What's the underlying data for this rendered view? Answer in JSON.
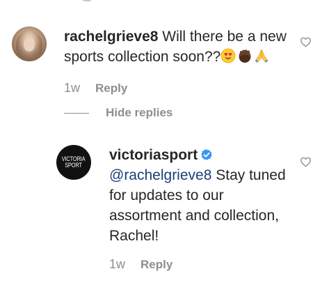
{
  "comments": [
    {
      "username": "rachelgrieve8",
      "text": " Will there be a new sports collection soon??",
      "emojis": [
        "heart-eyes-emoji",
        "raised-hand-dark-emoji",
        "folded-hands-emoji"
      ],
      "time": "1w",
      "reply_label": "Reply"
    }
  ],
  "replies_toggle": {
    "label": "Hide replies"
  },
  "replies": [
    {
      "username": "victoriasport",
      "verified": true,
      "mention": "@rachelgrieve8",
      "text": " Stay tuned for updates to our assortment and collection, Rachel!",
      "avatar_text": [
        "VICTORIA",
        "SPORT"
      ],
      "time": "1w",
      "reply_label": "Reply"
    }
  ],
  "colors": {
    "text": "#262626",
    "secondary": "#8e8e8e",
    "mention": "#1d3d7a",
    "verified": "#3897f0"
  }
}
